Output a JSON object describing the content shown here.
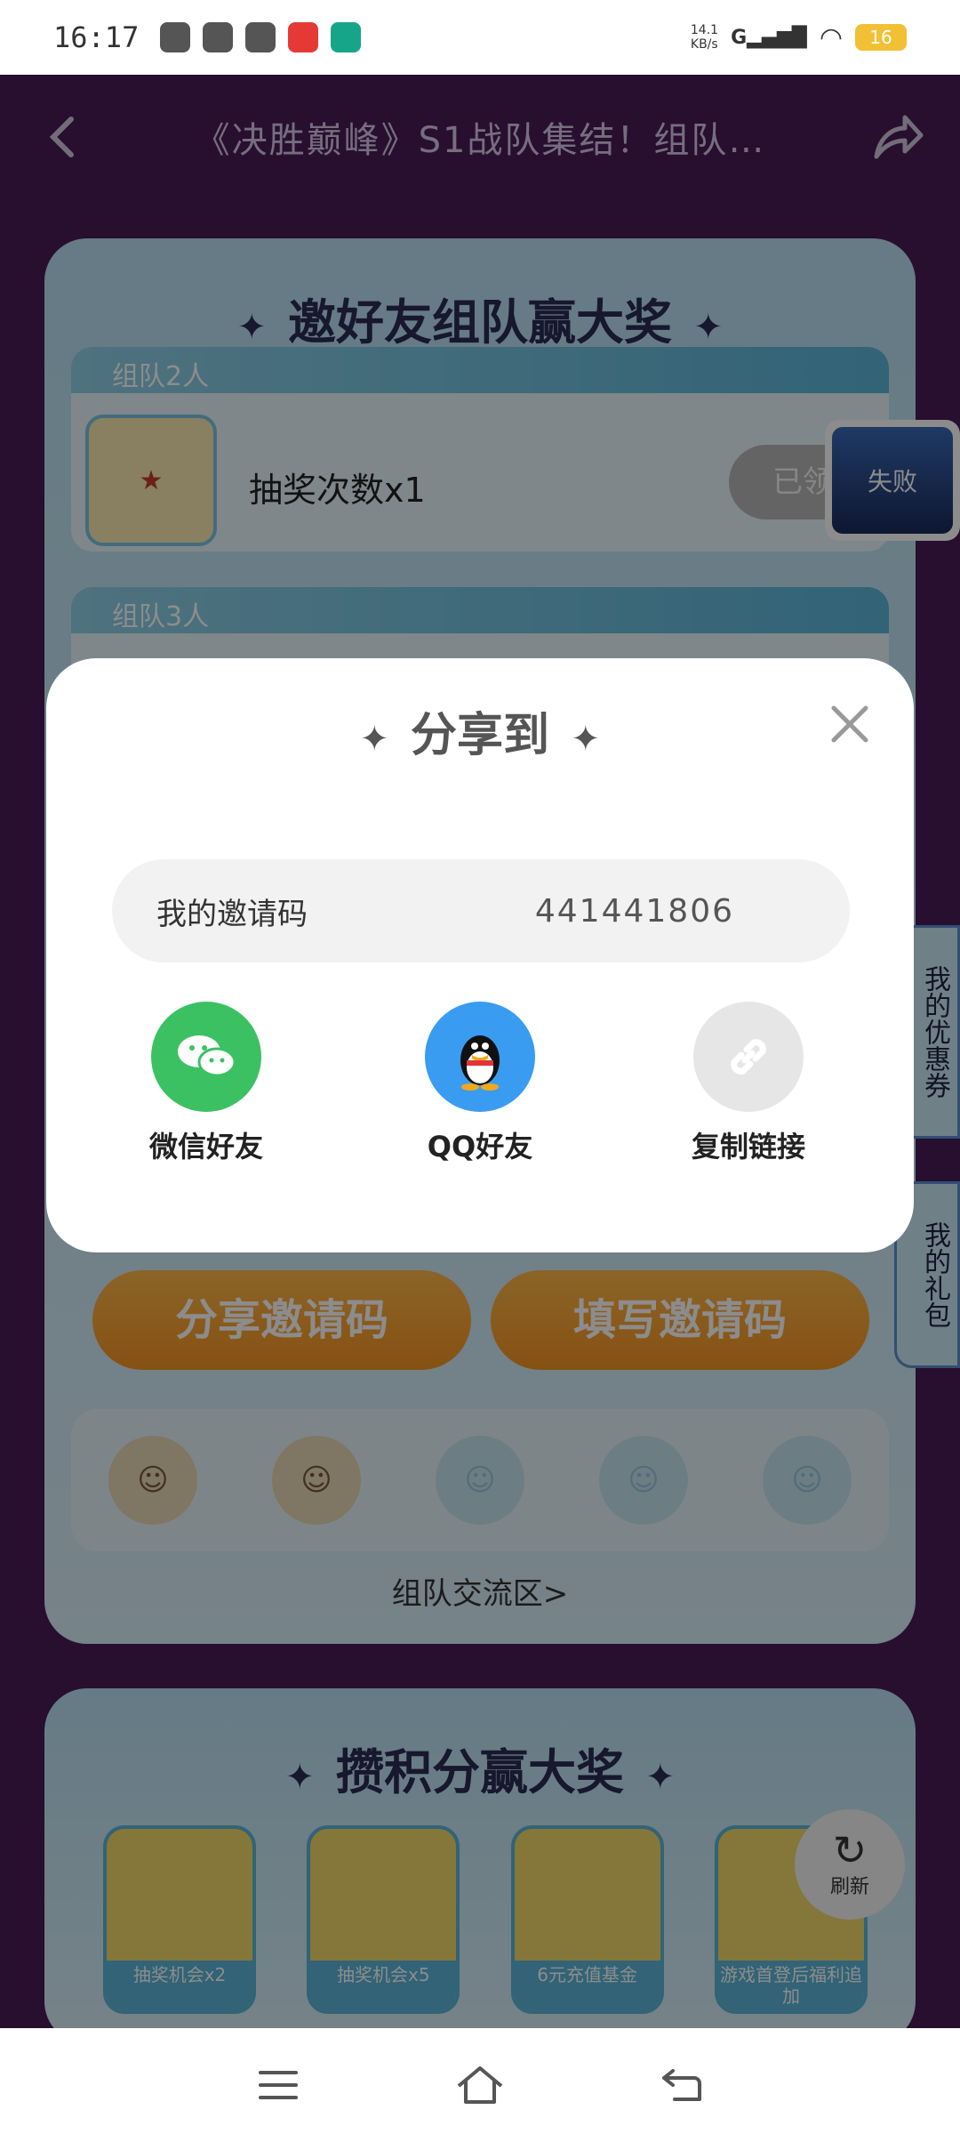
{
  "status": {
    "time": "16:17",
    "net_speed": "14.1\nKB/s",
    "signal": "G",
    "battery": "16"
  },
  "header": {
    "title": "《决胜巅峰》S1战队集结！组队…"
  },
  "panel_team": {
    "heading": "邀好友组队赢大奖",
    "tier1_tag": "组队2人",
    "tier1_prize": "抽奖次数x1",
    "tier1_status": "已领取",
    "tier2_tag": "组队3人",
    "share_code_btn": "分享邀请码",
    "fill_code_btn": "填写邀请码",
    "exchange_link": "组队交流区>"
  },
  "panel_points": {
    "heading": "攒积分赢大奖",
    "items": [
      {
        "label": "抽奖机会x2"
      },
      {
        "label": "抽奖机会x5"
      },
      {
        "label": "6元充值基金"
      },
      {
        "label": "游戏首登后福利追加"
      }
    ]
  },
  "float_game": {
    "label": "失败"
  },
  "side_tabs": {
    "coupons": "我的优惠券",
    "gifts": "我的礼包"
  },
  "refresh": {
    "label": "刷新"
  },
  "share_sheet": {
    "title": "分享到",
    "code_label": "我的邀请码",
    "code_value": "441441806",
    "options": [
      {
        "label": "微信好友",
        "icon": "wechat-icon",
        "color": "#3cc162"
      },
      {
        "label": "QQ好友",
        "icon": "qq-icon",
        "color": "#3a9cf0"
      },
      {
        "label": "复制链接",
        "icon": "link-icon",
        "color": "#e6e6e6"
      }
    ]
  }
}
